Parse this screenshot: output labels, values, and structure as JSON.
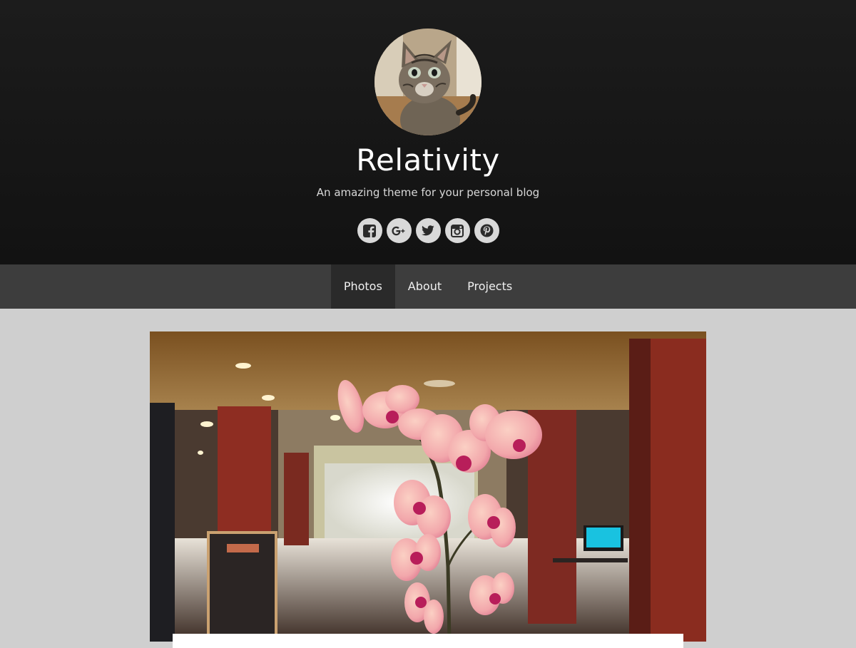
{
  "site": {
    "title": "Relativity",
    "tagline": "An amazing theme for your personal blog"
  },
  "social": [
    {
      "icon": "facebook-icon",
      "label": "Facebook"
    },
    {
      "icon": "google-plus-icon",
      "label": "Google+"
    },
    {
      "icon": "twitter-icon",
      "label": "Twitter"
    },
    {
      "icon": "instagram-icon",
      "label": "Instagram"
    },
    {
      "icon": "pinterest-icon",
      "label": "Pinterest"
    }
  ],
  "nav": {
    "items": [
      {
        "label": "Photos",
        "active": true
      },
      {
        "label": "About",
        "active": false
      },
      {
        "label": "Projects",
        "active": false
      }
    ]
  },
  "colors": {
    "header_bg": "#151515",
    "nav_bg": "#3d3d3d",
    "nav_active_bg": "#2a2a2a",
    "page_bg": "#cfcfcf",
    "social_btn_bg": "#d9d9d9"
  },
  "featured_image": {
    "subject": "pink-orchid-photo"
  },
  "avatar": {
    "subject": "kitten-photo"
  }
}
